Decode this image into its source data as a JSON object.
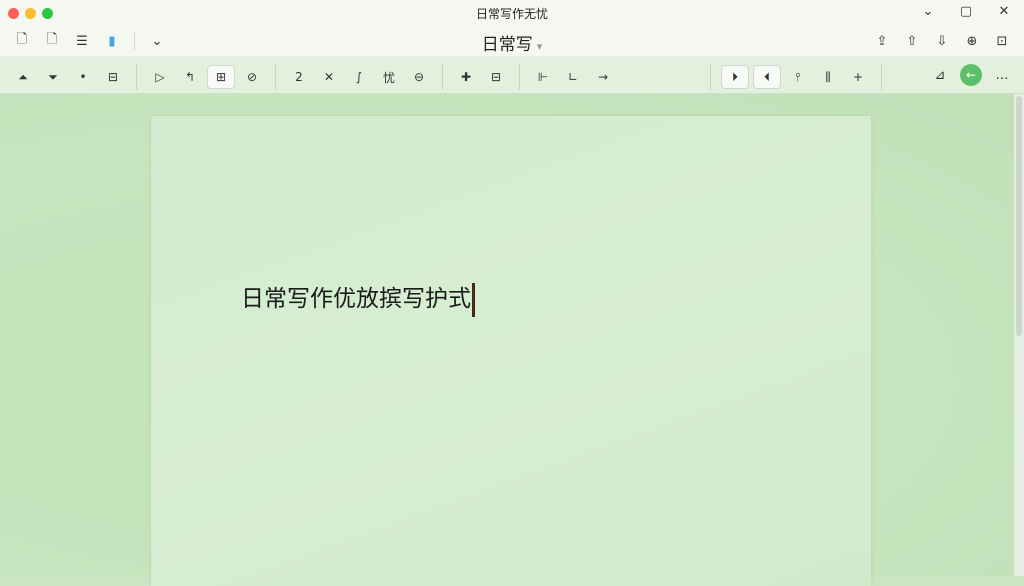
{
  "window": {
    "title": "日常写作无忧",
    "controls": [
      "⌄",
      "▢",
      "✕"
    ]
  },
  "toolbar1": {
    "left_icons": [
      "🗋",
      "🗋",
      "☰",
      "▮",
      "⌄"
    ],
    "doc_title": "日常写",
    "doc_title_caret": "▾",
    "right_icons": [
      "⇪",
      "⇧",
      "⇩",
      "⊕",
      "⊡"
    ]
  },
  "toolbar2": {
    "group1": [
      "⏶",
      "⏷",
      "•",
      "⊟"
    ],
    "group2": [
      "▷",
      "↰",
      "⊞",
      "⊘"
    ],
    "group3": [
      "2",
      "✕",
      "∫",
      "忧",
      "⊖"
    ],
    "group4": [
      "✚",
      "⊟"
    ],
    "group5": [
      "⊩",
      "∟",
      "→"
    ],
    "group6": [
      "⏵",
      "⏴",
      "⫯",
      "⫼",
      "+"
    ],
    "right_icons": [
      "⊿",
      "…"
    ],
    "avatar_initial": "←"
  },
  "document": {
    "text": "日常写作优放摈写护式"
  }
}
